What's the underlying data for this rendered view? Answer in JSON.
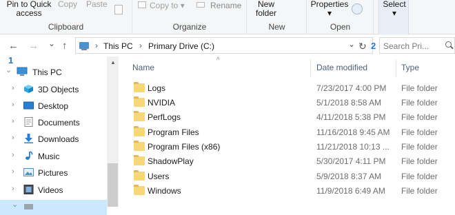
{
  "ribbon": {
    "clipboard": {
      "pin_line1": "Pin to Quick",
      "pin_line2": "access",
      "copy": "Copy",
      "paste": "Paste",
      "label": "Clipboard"
    },
    "organize": {
      "copy_to": "Copy to",
      "copy_to_arrow": "▾",
      "rename": "Rename",
      "label": "Organize"
    },
    "new": {
      "folder_line1": "New",
      "folder_line2": "folder",
      "label": "New"
    },
    "open": {
      "properties": "Properties",
      "properties_arrow": "▾",
      "label": "Open"
    },
    "select": {
      "label": "Select",
      "arrow": "▾"
    }
  },
  "nav": {
    "back": "←",
    "forward": "→",
    "history": "⌄",
    "up": "↑"
  },
  "address": {
    "crumbs": [
      "This PC",
      "Primary Drive (C:)"
    ],
    "chevron": "›",
    "dropdown": "⌄",
    "refresh": "↻",
    "search_placeholder": "Search Pri..."
  },
  "annotations": [
    "1",
    "2"
  ],
  "tree": {
    "root": "This PC",
    "items": [
      "3D Objects",
      "Desktop",
      "Documents",
      "Downloads",
      "Music",
      "Pictures",
      "Videos"
    ],
    "expander": "›",
    "root_expander": "⌄"
  },
  "columns": {
    "name": "Name",
    "date": "Date modified",
    "type": "Type",
    "sort_indicator": "^"
  },
  "files": [
    {
      "name": "Logs",
      "date": "7/23/2017 4:00 PM",
      "type": "File folder"
    },
    {
      "name": "NVIDIA",
      "date": "5/1/2018 8:58 AM",
      "type": "File folder"
    },
    {
      "name": "PerfLogs",
      "date": "4/11/2018 5:38 PM",
      "type": "File folder"
    },
    {
      "name": "Program Files",
      "date": "11/16/2018 9:45 AM",
      "type": "File folder"
    },
    {
      "name": "Program Files (x86)",
      "date": "11/21/2018 10:13 ...",
      "type": "File folder"
    },
    {
      "name": "ShadowPlay",
      "date": "5/30/2017 4:11 PM",
      "type": "File folder"
    },
    {
      "name": "Users",
      "date": "5/9/2018 8:37 AM",
      "type": "File folder"
    },
    {
      "name": "Windows",
      "date": "11/9/2018 6:49 AM",
      "type": "File folder"
    }
  ],
  "colors": {
    "accent": "#2277dd",
    "folder": "#f8d775",
    "header_text": "#4c607a"
  }
}
